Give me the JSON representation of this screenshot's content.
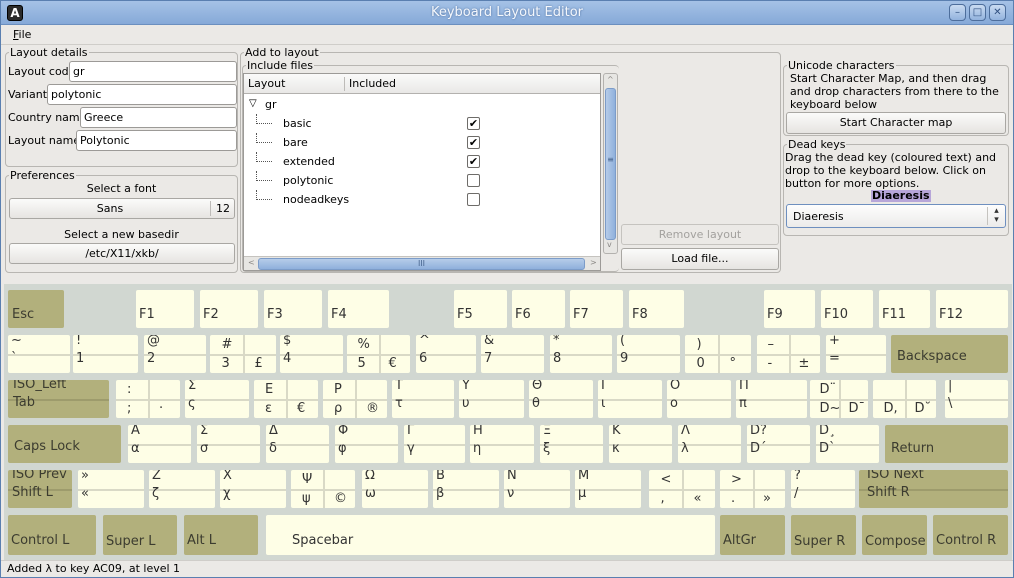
{
  "window": {
    "title": "Keyboard Layout Editor",
    "app_icon": "A",
    "controls": {
      "minimize": "–",
      "maximize": "□",
      "close": "✕"
    }
  },
  "menu": {
    "file_label": "File",
    "file_mnemonic": "F",
    "file_rest": "ile"
  },
  "layout_details": {
    "title": "Layout details",
    "fields": [
      {
        "label": "Layout code",
        "value": "gr"
      },
      {
        "label": "Variant",
        "value": "polytonic"
      },
      {
        "label": "Country name",
        "value": "Greece"
      },
      {
        "label": "Layout name",
        "value": "Polytonic"
      }
    ]
  },
  "preferences": {
    "title": "Preferences",
    "font_label": "Select a font",
    "font_name": "Sans",
    "font_size": "12",
    "basedir_label": "Select a new basedir",
    "basedir_value": "/etc/X11/xkb/"
  },
  "add_to_layout": {
    "title": "Add to layout",
    "include_title": "Include files",
    "columns": [
      "Layout",
      "Included"
    ],
    "root": {
      "name": "gr",
      "expander": "▽"
    },
    "items": [
      {
        "name": "basic",
        "included": true
      },
      {
        "name": "bare",
        "included": true
      },
      {
        "name": "extended",
        "included": true
      },
      {
        "name": "polytonic",
        "included": false
      },
      {
        "name": "nodeadkeys",
        "included": false
      }
    ],
    "remove_label": "Remove layout",
    "load_label": "Load file..."
  },
  "unicode": {
    "title": "Unicode characters",
    "description": "Start Character Map, and then drag and drop characters from there to the keyboard below",
    "button": "Start Character map"
  },
  "dead_keys": {
    "title": "Dead keys",
    "description": "Drag the dead key (coloured text) and drop to the keyboard below. Click on button for more options.",
    "chip": "Diaeresis",
    "selected": "Diaeresis",
    "chip_color": "#b7a6d9"
  },
  "colors": {
    "key_light": "#fefee6",
    "key_dark": "#b2b07c",
    "keyboard_bg": "#d1d7d1"
  },
  "keys": {
    "esc": "Esc",
    "f": [
      "F1",
      "F2",
      "F3",
      "F4",
      "F5",
      "F6",
      "F7",
      "F8",
      "F9",
      "F10",
      "F11",
      "F12"
    ],
    "backspace": "Backspace",
    "tab_top": "ISO_Left",
    "tab_bottom": "Tab",
    "caps": "Caps Lock",
    "return": "Return",
    "shiftl_top": "ISO Prev",
    "shiftl_bottom": "Shift L",
    "shiftr_top": "ISO Next",
    "shiftr_bottom": "Shift R",
    "control_l": "Control L",
    "super_l": "Super L",
    "alt_l": "Alt L",
    "spacebar": "Spacebar",
    "altgr": "AltGr",
    "super_r": "Super R",
    "compose": "Compose",
    "control_r": "Control R",
    "number_row": [
      {
        "tl": "~",
        "bl": "`"
      },
      {
        "tl": "!",
        "bl": "1"
      },
      {
        "tl": "@",
        "bl": "2"
      },
      {
        "tl": "#",
        "bl": "3",
        "br": "£"
      },
      {
        "tl": "$",
        "bl": "4"
      },
      {
        "tl": "%",
        "bl": "5",
        "br": "€"
      },
      {
        "tl": "^",
        "bl": "6"
      },
      {
        "tl": "&",
        "bl": "7"
      },
      {
        "tl": "*",
        "bl": "8"
      },
      {
        "tl": "(",
        "bl": "9"
      },
      {
        "tl": ")",
        "bl": "0",
        "br": "°"
      },
      {
        "tl": "–",
        "bl": "-",
        "br": "±"
      },
      {
        "tl": "+",
        "bl": "="
      }
    ],
    "top_row": [
      {
        "tl": ":",
        "bl": ";",
        "br": "·"
      },
      {
        "tl": "Σ",
        "bl": "ς"
      },
      {
        "tl": "Ε",
        "bl": "ε",
        "br": "€"
      },
      {
        "tl": "Ρ",
        "bl": "ρ",
        "br": "®"
      },
      {
        "tl": "Τ",
        "bl": "τ"
      },
      {
        "tl": "Υ",
        "bl": "υ"
      },
      {
        "tl": "Θ",
        "bl": "θ"
      },
      {
        "tl": "Ι",
        "bl": "ι"
      },
      {
        "tl": "Ο",
        "bl": "ο"
      },
      {
        "tl": "Π",
        "bl": "π"
      },
      {
        "tl": "D¨",
        "bl": "D~",
        "br": "D¯"
      },
      {
        "tl": "",
        "bl": "D,",
        "br": "D˘"
      },
      {
        "tl": "|",
        "bl": "\\"
      }
    ],
    "home_row": [
      {
        "tl": "Α",
        "bl": "α"
      },
      {
        "tl": "Σ",
        "bl": "σ"
      },
      {
        "tl": "Δ",
        "bl": "δ"
      },
      {
        "tl": "Φ",
        "bl": "φ"
      },
      {
        "tl": "Γ",
        "bl": "γ"
      },
      {
        "tl": "Η",
        "bl": "η"
      },
      {
        "tl": "Ξ",
        "bl": "ξ"
      },
      {
        "tl": "Κ",
        "bl": "κ"
      },
      {
        "tl": "Λ",
        "bl": "λ"
      },
      {
        "tl": "D?",
        "bl": "D´"
      },
      {
        "tl": "D¸",
        "bl": "D`"
      }
    ],
    "bottom_row": [
      {
        "tl": "»",
        "bl": "«"
      },
      {
        "tl": "Ζ",
        "bl": "ζ"
      },
      {
        "tl": "Χ",
        "bl": "χ"
      },
      {
        "tl": "Ψ",
        "bl": "ψ",
        "br": "©"
      },
      {
        "tl": "Ω",
        "bl": "ω"
      },
      {
        "tl": "Β",
        "bl": "β"
      },
      {
        "tl": "Ν",
        "bl": "ν"
      },
      {
        "tl": "Μ",
        "bl": "μ"
      },
      {
        "tl": "<",
        "bl": ",",
        "br": "«"
      },
      {
        "tl": ">",
        "bl": ".",
        "br": "»"
      },
      {
        "tl": "?",
        "bl": "/"
      }
    ]
  },
  "status": {
    "text": "Added λ to key AC09, at level 1"
  }
}
